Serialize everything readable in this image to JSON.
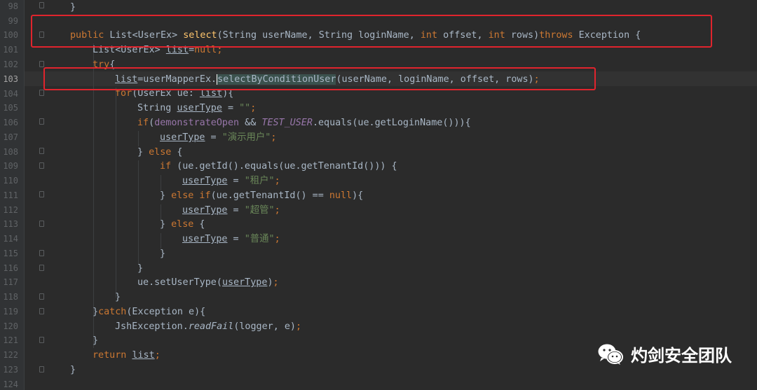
{
  "editor": {
    "gutter": {
      "line_numbers": [
        "98",
        "99",
        "100",
        "101",
        "102",
        "103",
        "104",
        "105",
        "106",
        "107",
        "108",
        "109",
        "110",
        "111",
        "112",
        "113",
        "114",
        "115",
        "116",
        "117",
        "118",
        "119",
        "120",
        "121",
        "122",
        "123",
        "124"
      ],
      "current_line": "103"
    }
  },
  "watermark": {
    "text": "灼剑安全团队",
    "icon": "wechat-icon"
  },
  "highlight_color": "#e0242d",
  "code": {
    "l98_brace": "}",
    "l100": {
      "public": "public",
      "list_type": " List<UserEx> ",
      "method": "select",
      "params1": "(String userName, String loginName, ",
      "int1": "int",
      "params2": " offset, ",
      "int2": "int",
      "params3": " rows)",
      "throws": "throws",
      "exception": " Exception {"
    },
    "l101": {
      "a": "List<UserEx> ",
      "var": "list",
      "eq": "=",
      "null": "null",
      "semi": ";"
    },
    "l102": {
      "try": "try",
      "brace": "{"
    },
    "l103": {
      "var": "list",
      "eq": "=userMapperEx.",
      "method": "selectByConditionUser",
      "args": "(userName, loginName, offset, rows)",
      "semi": ";"
    },
    "l104": {
      "for": "for",
      "rest": "(UserEx ue: ",
      "var": "list",
      "end": "){"
    },
    "l105": {
      "type": "String ",
      "var": "userType",
      "eq": " = ",
      "val": "\"\"",
      "semi": ";"
    },
    "l106": {
      "if": "if",
      "p1": "(",
      "demo": "demonstrateOpen",
      "and": " && ",
      "test": "TEST_USER",
      "rest": ".equals(ue.getLoginName())){"
    },
    "l107": {
      "var": "userType",
      "eq": " = ",
      "val": "\"演示用户\"",
      "semi": ";"
    },
    "l108": {
      "brace": "} ",
      "else": "else",
      "rest": " {"
    },
    "l109": {
      "if": "if",
      "rest": " (ue.getId().equals(ue.getTenantId())) {"
    },
    "l110": {
      "var": "userType",
      "eq": " = ",
      "val": "\"租户\"",
      "semi": ";"
    },
    "l111": {
      "brace": "} ",
      "else": "else if",
      "rest1": "(ue.getTenantId() == ",
      "null": "null",
      "rest2": "){"
    },
    "l112": {
      "var": "userType",
      "eq": " = ",
      "val": "\"超管\"",
      "semi": ";"
    },
    "l113": {
      "brace": "} ",
      "else": "else",
      "rest": " {"
    },
    "l114": {
      "var": "userType",
      "eq": " = ",
      "val": "\"普通\"",
      "semi": ";"
    },
    "l115": "}",
    "l116": "}",
    "l117": {
      "a": "ue.setUserType(",
      "var": "userType",
      "b": ")",
      "semi": ";"
    },
    "l118": "}",
    "l119": {
      "a": "}",
      "catch": "catch",
      "b": "(Exception e){"
    },
    "l120": {
      "a": "JshException.",
      "m": "readFail",
      "b": "(logger, e)",
      "semi": ";"
    },
    "l121": "}",
    "l122": {
      "ret": "return ",
      "var": "list",
      "semi": ";"
    },
    "l123": "}"
  }
}
